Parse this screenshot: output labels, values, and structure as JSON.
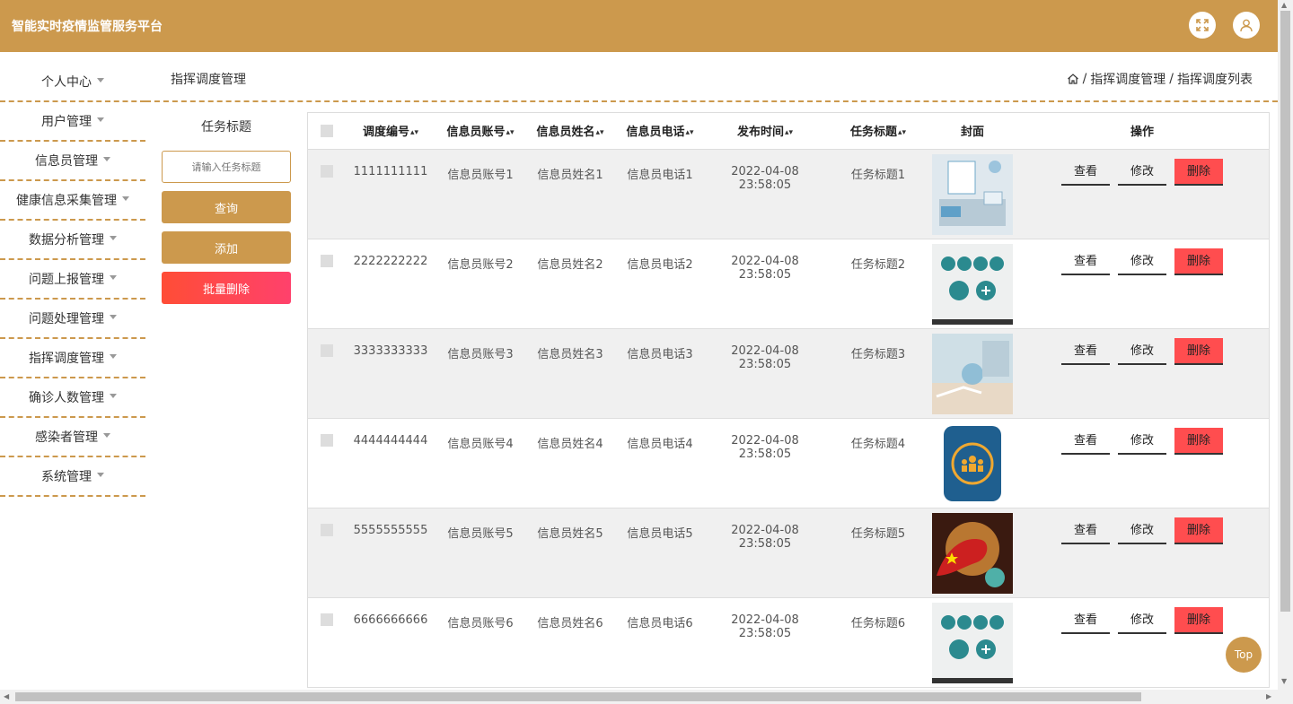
{
  "header": {
    "title": "智能实时疫情监管服务平台"
  },
  "sidebar": {
    "items": [
      {
        "label": "个人中心"
      },
      {
        "label": "用户管理"
      },
      {
        "label": "信息员管理"
      },
      {
        "label": "健康信息采集管理"
      },
      {
        "label": "数据分析管理"
      },
      {
        "label": "问题上报管理"
      },
      {
        "label": "问题处理管理"
      },
      {
        "label": "指挥调度管理"
      },
      {
        "label": "确诊人数管理"
      },
      {
        "label": "感染者管理"
      },
      {
        "label": "系统管理"
      }
    ]
  },
  "page": {
    "title": "指挥调度管理",
    "crumb1": "指挥调度管理",
    "crumb2": "指挥调度列表",
    "sep": "/"
  },
  "filter": {
    "label": "任务标题",
    "placeholder": "请输入任务标题",
    "query": "查询",
    "add": "添加",
    "batch_delete": "批量删除"
  },
  "table": {
    "headers": [
      "调度编号",
      "信息员账号",
      "信息员姓名",
      "信息员电话",
      "发布时间",
      "任务标题",
      "封面",
      "操作"
    ],
    "rows": [
      {
        "code": "1111111111",
        "account": "信息员账号1",
        "name": "信息员姓名1",
        "phone": "信息员电话1",
        "time": "2022-04-08 23:58:05",
        "task": "任务标题1"
      },
      {
        "code": "2222222222",
        "account": "信息员账号2",
        "name": "信息员姓名2",
        "phone": "信息员电话2",
        "time": "2022-04-08 23:58:05",
        "task": "任务标题2"
      },
      {
        "code": "3333333333",
        "account": "信息员账号3",
        "name": "信息员姓名3",
        "phone": "信息员电话3",
        "time": "2022-04-08 23:58:05",
        "task": "任务标题3"
      },
      {
        "code": "4444444444",
        "account": "信息员账号4",
        "name": "信息员姓名4",
        "phone": "信息员电话4",
        "time": "2022-04-08 23:58:05",
        "task": "任务标题4"
      },
      {
        "code": "5555555555",
        "account": "信息员账号5",
        "name": "信息员姓名5",
        "phone": "信息员电话5",
        "time": "2022-04-08 23:58:05",
        "task": "任务标题5"
      },
      {
        "code": "6666666666",
        "account": "信息员账号6",
        "name": "信息员姓名6",
        "phone": "信息员电话6",
        "time": "2022-04-08 23:58:05",
        "task": "任务标题6"
      }
    ],
    "actions": {
      "view": "查看",
      "edit": "修改",
      "delete": "删除"
    }
  },
  "top_button": "Top",
  "colors": {
    "accent": "#cc994d",
    "danger": "#ff4d4f"
  }
}
